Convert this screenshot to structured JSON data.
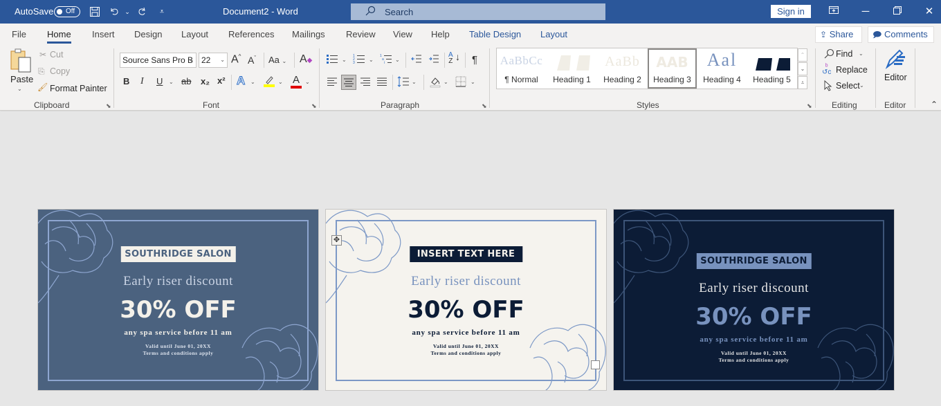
{
  "titlebar": {
    "autosave_label": "AutoSave",
    "autosave_state": "Off",
    "document_title": "Document2  -  Word",
    "search_placeholder": "Search",
    "signin_label": "Sign in",
    "icons": [
      "save-icon",
      "undo-icon",
      "redo-icon",
      "customize-qat-icon",
      "ribbon-display-icon",
      "minimize-icon",
      "restore-icon",
      "close-icon"
    ]
  },
  "tabs": [
    {
      "label": "File"
    },
    {
      "label": "Home",
      "active": true
    },
    {
      "label": "Insert"
    },
    {
      "label": "Design"
    },
    {
      "label": "Layout"
    },
    {
      "label": "References"
    },
    {
      "label": "Mailings"
    },
    {
      "label": "Review"
    },
    {
      "label": "View"
    },
    {
      "label": "Help"
    },
    {
      "label": "Table Design",
      "contextual": true
    },
    {
      "label": "Layout",
      "contextual": true
    }
  ],
  "share_label": "Share",
  "comments_label": "Comments",
  "ribbon": {
    "clipboard": {
      "label": "Clipboard",
      "paste": "Paste",
      "cut": "Cut",
      "copy": "Copy",
      "format_painter": "Format Painter"
    },
    "font": {
      "label": "Font",
      "font_name": "Source Sans Pro B",
      "font_size": "22",
      "grow": "A",
      "shrink": "A",
      "change_case": "Aa",
      "bold": "B",
      "italic": "I",
      "underline": "U",
      "strikethrough": "ab",
      "subscript": "x₂",
      "superscript": "x²",
      "highlight_color": "#ffff00",
      "font_color": "#e00000"
    },
    "paragraph": {
      "label": "Paragraph",
      "pilcrow": "¶"
    },
    "styles": {
      "label": "Styles",
      "items": [
        {
          "preview": "AaBbCc",
          "name": "¶ Normal",
          "color": "#c9d3e4"
        },
        {
          "preview": "",
          "name": "Heading 1",
          "color": "#f1eee6"
        },
        {
          "preview": "AaBb",
          "name": "Heading 2",
          "color": "#ece8de"
        },
        {
          "preview": "AAB",
          "name": "Heading 3",
          "color": "#efebe2",
          "selected": true
        },
        {
          "preview": "Aal",
          "name": "Heading 4",
          "color": "#7892be"
        },
        {
          "preview": "",
          "name": "Heading 5",
          "color": "#0c1c36"
        }
      ]
    },
    "editing": {
      "label": "Editing",
      "find": "Find",
      "replace": "Replace",
      "select": "Select"
    },
    "editor": {
      "label": "Editor",
      "button": "Editor"
    }
  },
  "cards": [
    {
      "badge": "SOUTHRIDGE SALON",
      "subtitle": "Early riser discount",
      "offer": "30% OFF",
      "service": "any spa service before 11 am",
      "valid": "Valid until June 01, 20XX",
      "terms": "Terms and conditions apply",
      "colors": {
        "bg": "#4b627f",
        "frame": "#8ea6d0",
        "badge_bg": "#f4f1ea",
        "badge_fg": "#4b627f",
        "subtitle": "#c9d3e4",
        "offer": "#f4f1ea",
        "service": "#f4f1ea",
        "small": "#dfe5ef",
        "flower": "#8ea6d0"
      }
    },
    {
      "badge": "INSERT TEXT HERE",
      "subtitle": "Early riser discount",
      "offer": "30% OFF",
      "service": "any spa service before 11 am",
      "valid": "Valid until June 01, 20XX",
      "terms": "Terms and conditions apply",
      "colors": {
        "bg": "#f5f3ee",
        "frame": "#7c98c6",
        "badge_bg": "#0c1c36",
        "badge_fg": "#f4f1ea",
        "subtitle": "#7892be",
        "offer": "#0c1c36",
        "service": "#0c1c36",
        "small": "#0c1c36",
        "flower": "#7c98c6"
      }
    },
    {
      "badge": "SOUTHRIDGE SALON",
      "subtitle": "Early riser discount",
      "offer": "30% OFF",
      "service": "any spa service before 11 am",
      "valid": "Valid until June 01, 20XX",
      "terms": "Terms and conditions apply",
      "colors": {
        "bg": "#0c1c36",
        "frame": "#3d5579",
        "badge_bg": "#7892be",
        "badge_fg": "#0c1c36",
        "subtitle": "#e6e6e6",
        "offer": "#7892be",
        "service": "#7892be",
        "small": "#e6e6e6",
        "flower": "#3d5579"
      }
    }
  ]
}
